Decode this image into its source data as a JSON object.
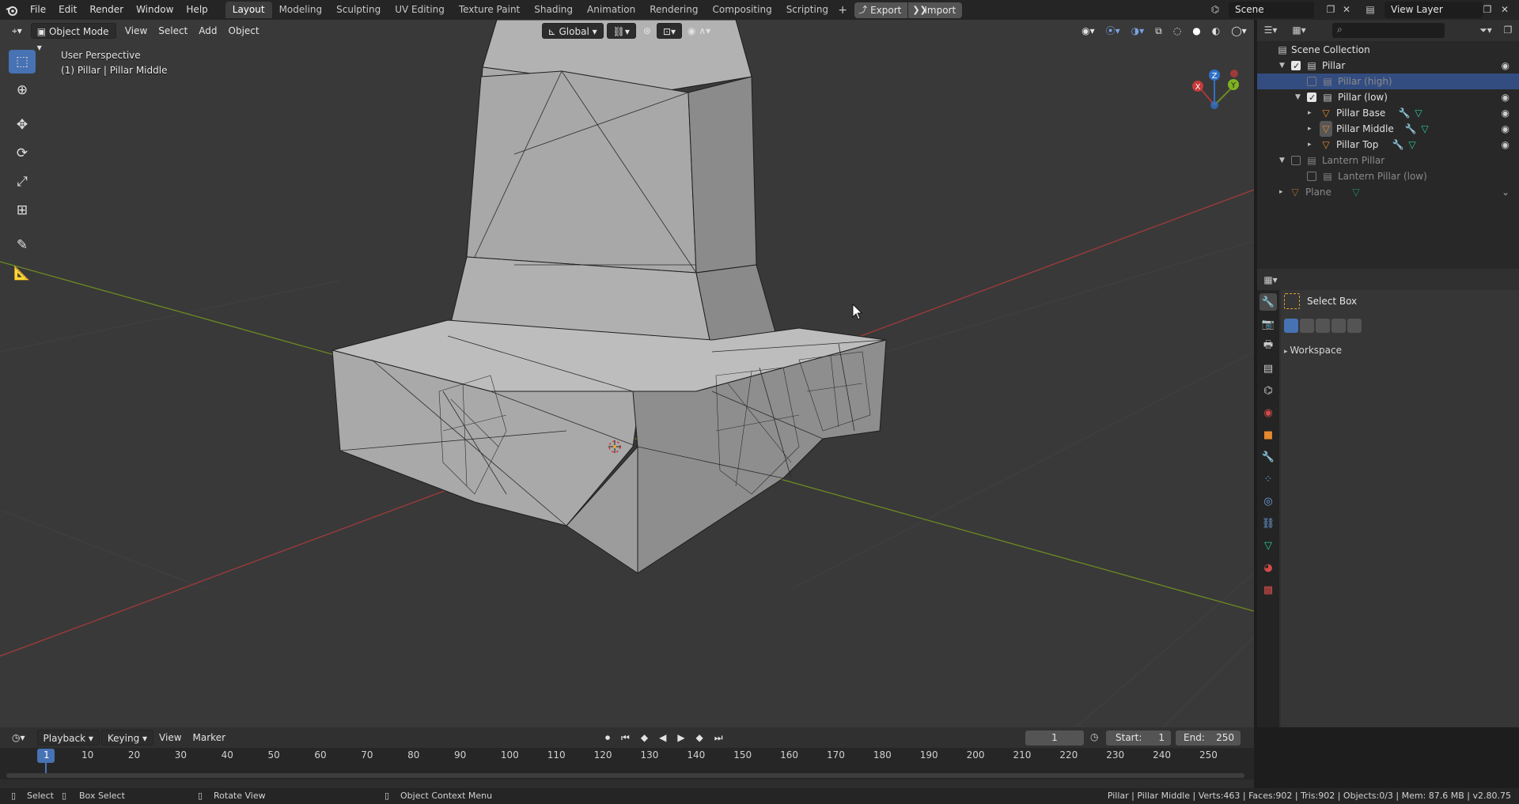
{
  "topbar": {
    "menus": [
      "File",
      "Edit",
      "Render",
      "Window",
      "Help"
    ],
    "workspaces": [
      "Layout",
      "Modeling",
      "Sculpting",
      "UV Editing",
      "Texture Paint",
      "Shading",
      "Animation",
      "Rendering",
      "Compositing",
      "Scripting"
    ],
    "active_workspace": "Layout",
    "export_label": "Export",
    "import_label": "Import",
    "scene_name": "Scene",
    "view_layer_name": "View Layer"
  },
  "viewport": {
    "mode": "Object Mode",
    "menus": [
      "View",
      "Select",
      "Add",
      "Object"
    ],
    "transform_orientation": "Global",
    "perspective_label": "User Perspective",
    "object_label": "(1) Pillar | Pillar Middle",
    "gizmo_axes": [
      "X",
      "Y",
      "Z"
    ]
  },
  "outliner": {
    "root": "Scene Collection",
    "rows": [
      {
        "label": "Pillar",
        "depth": 0,
        "checked": true,
        "type": "collection",
        "eye": true
      },
      {
        "label": "Pillar (high)",
        "depth": 1,
        "checked": false,
        "type": "collection",
        "selected": true,
        "dim": true
      },
      {
        "label": "Pillar (low)",
        "depth": 1,
        "checked": true,
        "type": "collection",
        "eye": true
      },
      {
        "label": "Pillar Base",
        "depth": 2,
        "type": "object",
        "eye": true
      },
      {
        "label": "Pillar Middle",
        "depth": 2,
        "type": "object",
        "eye": true
      },
      {
        "label": "Pillar Top",
        "depth": 2,
        "type": "object",
        "eye": true
      },
      {
        "label": "Lantern Pillar",
        "depth": 0,
        "checked": false,
        "type": "collection",
        "dim": true
      },
      {
        "label": "Lantern Pillar (low)",
        "depth": 1,
        "checked": false,
        "type": "collection",
        "dim": true
      },
      {
        "label": "Plane",
        "depth": 0,
        "type": "object",
        "dim": true
      }
    ]
  },
  "properties": {
    "tool_name": "Select Box",
    "workspace_panel": "Workspace"
  },
  "timeline": {
    "menus": [
      "Playback",
      "Keying",
      "View",
      "Marker"
    ],
    "current_frame": "1",
    "start_label": "Start:",
    "start_value": "1",
    "end_label": "End:",
    "end_value": "250",
    "ticks": [
      "1",
      "10",
      "20",
      "30",
      "40",
      "50",
      "60",
      "70",
      "80",
      "90",
      "100",
      "110",
      "120",
      "130",
      "140",
      "150",
      "160",
      "170",
      "180",
      "190",
      "200",
      "210",
      "220",
      "230",
      "240",
      "250"
    ]
  },
  "statusbar": {
    "select": "Select",
    "box_select": "Box Select",
    "rotate_view": "Rotate View",
    "context_menu": "Object Context Menu",
    "stats": "Pillar | Pillar Middle | Verts:463 | Faces:902 | Tris:902 | Objects:0/3 | Mem: 87.6 MB | v2.80.75"
  },
  "colors": {
    "accent": "#4772b3",
    "selected_row": "#334d80",
    "x_axis": "#a33a3a",
    "y_axis": "#6c8a22",
    "z_axis": "#2f71c8"
  }
}
